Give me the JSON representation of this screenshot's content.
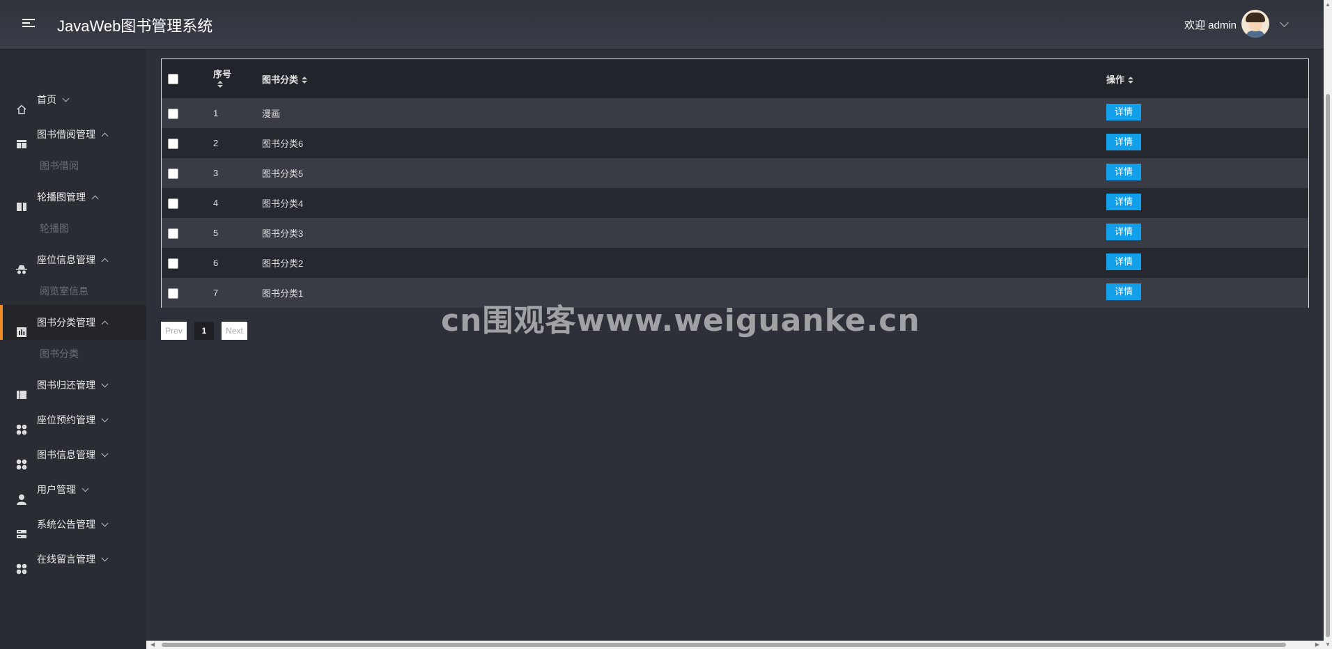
{
  "header": {
    "title": "JavaWeb图书管理系统",
    "welcome": "欢迎 admin"
  },
  "sidebar": {
    "items": [
      {
        "label": "首页",
        "icon": "home-icon",
        "arrow": "down"
      },
      {
        "label": "图书借阅管理",
        "icon": "table-icon",
        "arrow": "up",
        "sub": "图书借阅"
      },
      {
        "label": "轮播图管理",
        "icon": "columns-icon",
        "arrow": "up",
        "sub": "轮播图"
      },
      {
        "label": "座位信息管理",
        "icon": "incognito-icon",
        "arrow": "up",
        "sub": "阅览室信息"
      },
      {
        "label": "图书分类管理",
        "icon": "chart-icon",
        "arrow": "up",
        "sub": "图书分类",
        "active": true
      },
      {
        "label": "图书归还管理",
        "icon": "book-icon",
        "arrow": "down"
      },
      {
        "label": "座位预约管理",
        "icon": "grid-icon",
        "arrow": "down"
      },
      {
        "label": "图书信息管理",
        "icon": "grid-icon",
        "arrow": "down"
      },
      {
        "label": "用户管理",
        "icon": "user-icon",
        "arrow": "down"
      },
      {
        "label": "系统公告管理",
        "icon": "server-icon",
        "arrow": "down"
      },
      {
        "label": "在线留言管理",
        "icon": "grid-icon",
        "arrow": "down"
      }
    ]
  },
  "table": {
    "headers": {
      "no": "序号",
      "category": "图书分类",
      "action": "操作"
    },
    "rows": [
      {
        "no": "1",
        "category": "漫画",
        "action": "详情"
      },
      {
        "no": "2",
        "category": "图书分类6",
        "action": "详情"
      },
      {
        "no": "3",
        "category": "图书分类5",
        "action": "详情"
      },
      {
        "no": "4",
        "category": "图书分类4",
        "action": "详情"
      },
      {
        "no": "5",
        "category": "图书分类3",
        "action": "详情"
      },
      {
        "no": "6",
        "category": "图书分类2",
        "action": "详情"
      },
      {
        "no": "7",
        "category": "图书分类1",
        "action": "详情"
      }
    ]
  },
  "pager": {
    "prev": "Prev",
    "page": "1",
    "next": "Next"
  },
  "watermark": "cn围观客www.weiguanke.cn",
  "colors": {
    "accent": "#f08a24",
    "button": "#12a0ea",
    "background": "#2e3039"
  }
}
